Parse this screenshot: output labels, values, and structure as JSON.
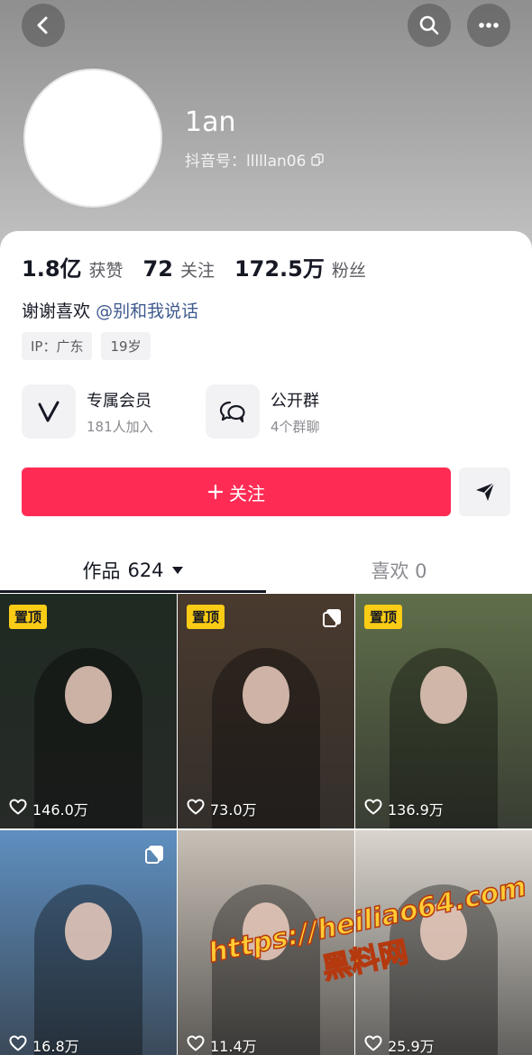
{
  "profile": {
    "nickname": "1an",
    "douyin_id": "抖音号：lllllan06"
  },
  "stats": {
    "likes_value": "1.8亿",
    "likes_label": "获赞",
    "following_value": "72",
    "following_label": "关注",
    "followers_value": "172.5万",
    "followers_label": "粉丝"
  },
  "bio": {
    "text": "谢谢喜欢",
    "mention": "@别和我说话"
  },
  "tags": [
    "IP：广东",
    "19岁"
  ],
  "entries": [
    {
      "title": "专属会员",
      "subtitle": "181人加入",
      "icon": "vip-v-icon"
    },
    {
      "title": "公开群",
      "subtitle": "4个群聊",
      "icon": "group-chat-icon"
    }
  ],
  "actions": {
    "follow_label": "关注"
  },
  "tabs": {
    "works_label": "作品",
    "works_count": "624",
    "likes_label": "喜欢 0"
  },
  "pin_label": "置顶",
  "videos": [
    {
      "likes": "146.0万",
      "pinned": true,
      "multi": false,
      "bg": "#1f2a22"
    },
    {
      "likes": "73.0万",
      "pinned": true,
      "multi": true,
      "bg": "#4a3a2e"
    },
    {
      "likes": "136.9万",
      "pinned": true,
      "multi": false,
      "bg": "#5f6f4a"
    },
    {
      "likes": "16.8万",
      "pinned": false,
      "multi": true,
      "bg": "#5f8fc0"
    },
    {
      "likes": "11.4万",
      "pinned": false,
      "multi": false,
      "bg": "#c8c0b6"
    },
    {
      "likes": "25.9万",
      "pinned": false,
      "multi": false,
      "bg": "#d9d4cc"
    }
  ],
  "watermark": {
    "url": "https://heiliao64.com",
    "name": "黑料网"
  }
}
